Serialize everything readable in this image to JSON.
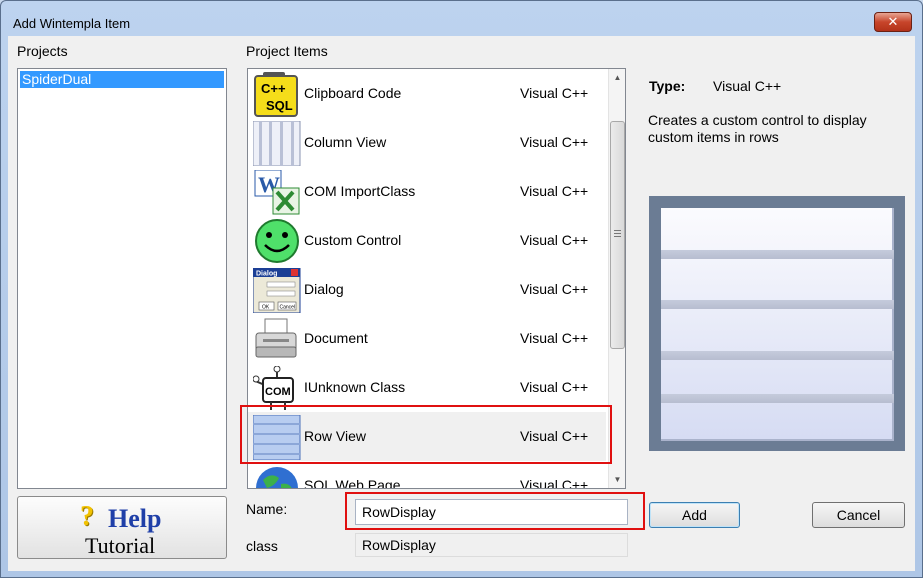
{
  "window": {
    "title": "Add Wintempla Item",
    "close_glyph": "✕"
  },
  "projects": {
    "label": "Projects",
    "items": [
      "SpiderDual"
    ]
  },
  "project_items": {
    "label": "Project Items",
    "items": [
      {
        "name": "Clipboard Code",
        "lang": "Visual C++",
        "icon": "cpp-sql-clipboard-icon",
        "icon_text_1": "C++",
        "icon_text_2": "SQL"
      },
      {
        "name": "Column View",
        "lang": "Visual C++",
        "icon": "column-view-icon"
      },
      {
        "name": "COM ImportClass",
        "lang": "Visual C++",
        "icon": "word-excel-icon",
        "icon_text_1": "W"
      },
      {
        "name": "Custom Control",
        "lang": "Visual C++",
        "icon": "smiley-icon"
      },
      {
        "name": "Dialog",
        "lang": "Visual C++",
        "icon": "dialog-window-icon",
        "icon_text_1": "Dialog",
        "icon_text_2": "OK",
        "icon_text_3": "Cancel"
      },
      {
        "name": "Document",
        "lang": "Visual C++",
        "icon": "printer-icon"
      },
      {
        "name": "IUnknown Class",
        "lang": "Visual C++",
        "icon": "com-chip-icon",
        "icon_text_1": "COM"
      },
      {
        "name": "Row View",
        "lang": "Visual C++",
        "icon": "row-view-icon"
      },
      {
        "name": "SQL Web Page",
        "lang": "Visual C++",
        "icon": "globe-icon"
      }
    ],
    "selected": "Row View"
  },
  "details": {
    "type_label": "Type:",
    "type_value": "Visual C++",
    "description": "Creates a custom control to display custom items in rows"
  },
  "form": {
    "name_label": "Name:",
    "name_value": "RowDisplay",
    "class_label": "class",
    "class_value": "RowDisplay"
  },
  "buttons": {
    "add": "Add",
    "cancel": "Cancel"
  },
  "help": {
    "question_mark": "?",
    "line1": "Help",
    "line2": "Tutorial"
  },
  "colors": {
    "selection": "#3399ff",
    "highlight": "#e01010",
    "accent": "#1f3fa8"
  }
}
